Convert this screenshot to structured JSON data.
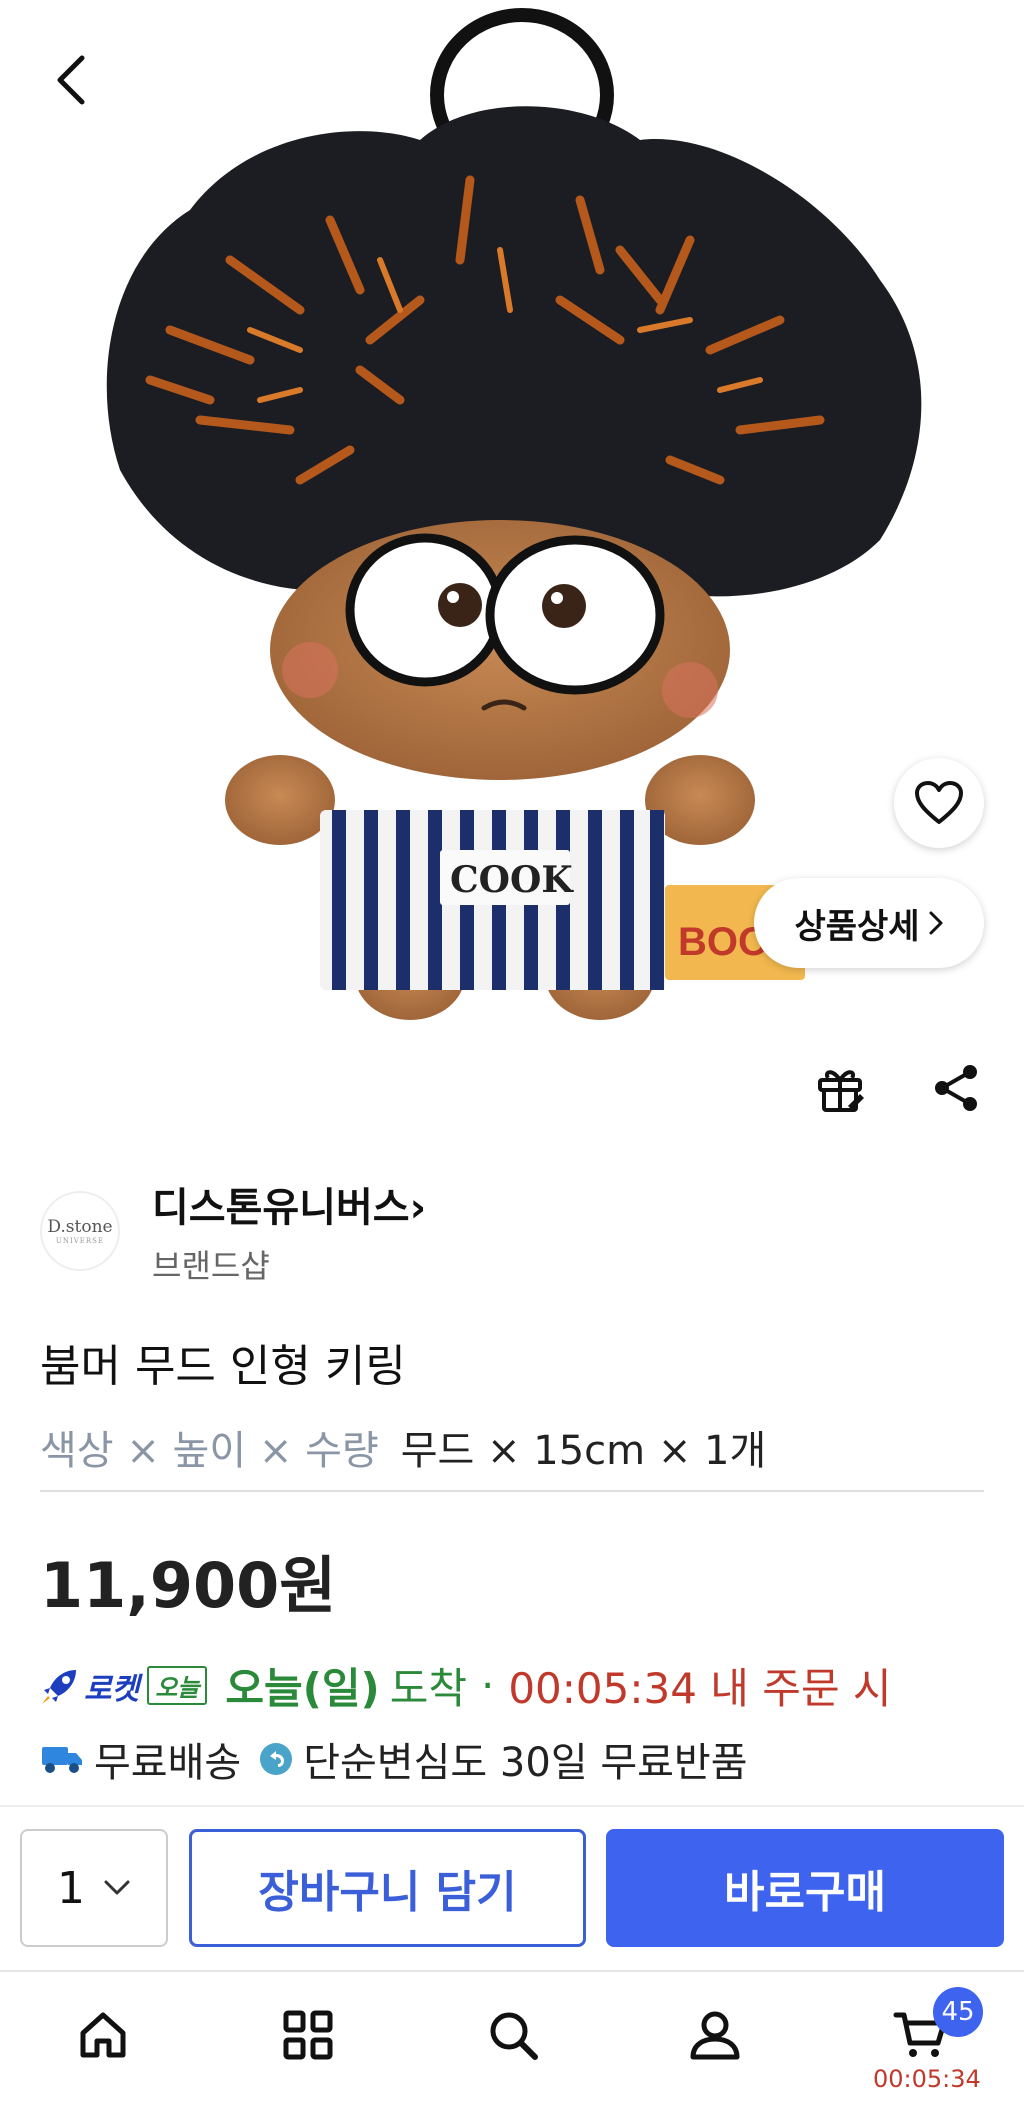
{
  "header": {
    "back_icon": "chevron-left-icon"
  },
  "hero": {
    "favorite_icon": "heart-outline-icon",
    "detail_label": "상품상세",
    "detail_icon": "chevron-right-icon",
    "image_caption": "COOK",
    "tag_text": "BOO"
  },
  "actions": {
    "gift_icon": "gift-icon",
    "share_icon": "share-icon"
  },
  "brand": {
    "logo_text": "D.stone",
    "logo_subtext": "UNIVERSE",
    "name": "디스톤유니버스",
    "chevron": "›",
    "type": "브랜드샵"
  },
  "product": {
    "title": "붐머 무드 인형 키링",
    "option_keys": "색상 × 높이 × 수량",
    "option_values": "무드 × 15cm × 1개",
    "price": "11,900원"
  },
  "delivery": {
    "rocket_label": "로켓",
    "today_label": "오늘",
    "arrive_day": "오늘(일)",
    "arrive_word": "도착",
    "separator": "·",
    "countdown": "00:05:34 내 주문 시",
    "free_shipping": "무료배송",
    "return_policy": "단순변심도 30일 무료반품"
  },
  "buybar": {
    "quantity": "1",
    "cart_button": "장바구니 담기",
    "buy_button": "바로구매"
  },
  "navbar": {
    "items": [
      "home-icon",
      "category-icon",
      "search-icon",
      "my-page-icon",
      "cart-icon"
    ],
    "cart_badge": "45",
    "cart_timer": "00:05:34"
  },
  "colors": {
    "accent": "#3e63ef",
    "rocket_green": "#2a8a3a",
    "countdown_red": "#c0392b"
  }
}
